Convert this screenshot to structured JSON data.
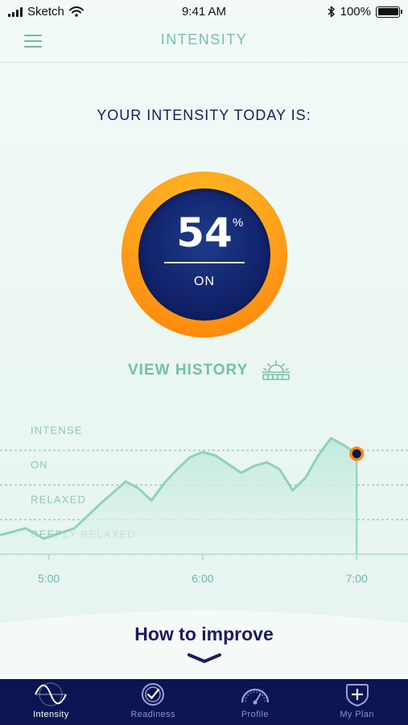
{
  "status_bar": {
    "carrier": "Sketch",
    "time": "9:41 AM",
    "battery": "100%",
    "icons": [
      "signal-icon",
      "wifi-icon",
      "bluetooth-icon",
      "battery-icon"
    ]
  },
  "nav": {
    "title": "INTENSITY",
    "menu_icon": "hamburger-menu-icon"
  },
  "headline": "YOUR INTENSITY TODAY IS:",
  "gauge": {
    "value": "54",
    "unit": "%",
    "state": "ON",
    "level_fraction": 0.54
  },
  "view_history": {
    "label": "VIEW HISTORY",
    "icon": "sunrise-icon"
  },
  "chart_data": {
    "type": "area",
    "levels": [
      "INTENSE",
      "ON",
      "RELAXED",
      "DEEPLY RELAXED"
    ],
    "x_ticks": [
      "5:00",
      "6:00",
      "7:00"
    ],
    "xlim": [
      "4:41",
      "7:20"
    ],
    "x": [
      "4:41",
      "4:51",
      "4:58",
      "5:10",
      "5:20",
      "5:30",
      "5:35",
      "5:40",
      "5:45",
      "5:50",
      "5:55",
      "6:00",
      "6:05",
      "6:10",
      "6:15",
      "6:20",
      "6:25",
      "6:30",
      "6:35",
      "6:40",
      "6:45",
      "6:50",
      "6:55",
      "7:00"
    ],
    "y": [
      0.55,
      0.75,
      0.45,
      0.75,
      1.45,
      2.1,
      1.9,
      1.55,
      2.05,
      2.45,
      2.8,
      2.95,
      2.85,
      2.6,
      2.35,
      2.55,
      2.65,
      2.45,
      1.85,
      2.2,
      2.85,
      3.35,
      3.15,
      2.9
    ],
    "y_level_lines": [
      3.0,
      2.0,
      1.0
    ],
    "current_point": {
      "x": "7:00",
      "y": 2.9
    },
    "colors": {
      "line": "#8fd1c1",
      "fill_top": "#c4ebe0",
      "marker_fill": "#0b1551",
      "marker_ring": "#ff8a0e"
    }
  },
  "improve": {
    "title": "How to improve",
    "icon": "chevron-down-icon"
  },
  "tabs": [
    {
      "label": "Intensity",
      "icon": "wave-icon",
      "active": true
    },
    {
      "label": "Readiness",
      "icon": "check-circle-icon",
      "active": false
    },
    {
      "label": "Profile",
      "icon": "gauge-icon",
      "active": false
    },
    {
      "label": "My Plan",
      "icon": "shield-plus-icon",
      "active": false
    }
  ],
  "colors": {
    "accent": "#74bfae",
    "navy": "#1c1a5e",
    "tabbar": "#0b1551",
    "gauge_orange": "#ff9a18"
  }
}
